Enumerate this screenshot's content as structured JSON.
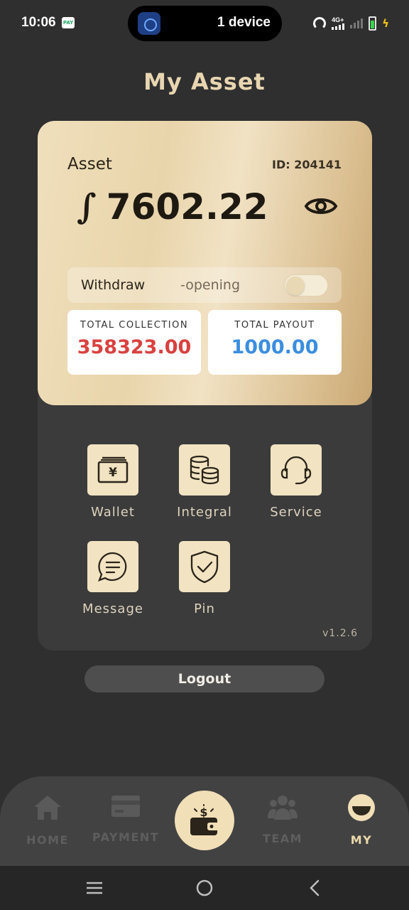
{
  "status_bar": {
    "time": "10:06",
    "pay_badge": "PAY",
    "live_activity": "1 device",
    "network": "4G+"
  },
  "page": {
    "title": "My Asset"
  },
  "asset_card": {
    "label": "Asset",
    "id_text": "ID: 204141",
    "currency_symbol": "∫",
    "amount": "7602.22",
    "withdraw_label": "Withdraw",
    "withdraw_status": "-opening",
    "total_collection_label": "TOTAL COLLECTION",
    "total_collection_value": "358323.00",
    "total_payout_label": "TOTAL PAYOUT",
    "total_payout_value": "1000.00",
    "colors": {
      "collection": "#d9413f",
      "payout": "#3b8ee0"
    }
  },
  "menu": {
    "items": [
      {
        "label": "Wallet",
        "icon": "wallet-yen-icon"
      },
      {
        "label": "Integral",
        "icon": "coins-stack-icon"
      },
      {
        "label": "Service",
        "icon": "headset-icon"
      },
      {
        "label": "Message",
        "icon": "chat-bubble-icon"
      },
      {
        "label": "Pin",
        "icon": "shield-check-icon"
      }
    ],
    "version": "v1.2.6"
  },
  "logout_label": "Logout",
  "bottom_nav": {
    "items": [
      {
        "label": "HOME",
        "icon": "home-icon"
      },
      {
        "label": "PAYMENT",
        "icon": "card-icon"
      },
      {
        "label": "",
        "icon": "wallet-dollar-icon"
      },
      {
        "label": "TEAM",
        "icon": "team-icon"
      },
      {
        "label": "MY",
        "icon": "profile-icon"
      }
    ],
    "active": "MY",
    "accent": "#ecd9ad"
  }
}
